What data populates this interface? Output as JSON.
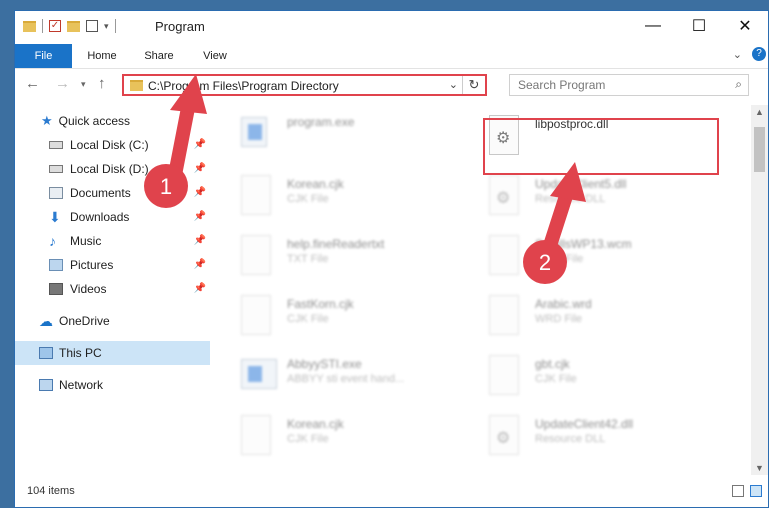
{
  "window": {
    "title": "Program"
  },
  "window_buttons": {
    "minimize": "—",
    "maximize": "☐",
    "close": "✕"
  },
  "ribbon": {
    "tabs": [
      "File",
      "Home",
      "Share",
      "View"
    ]
  },
  "address": {
    "path": "C:\\Program Files\\Program Directory",
    "dropdown": "⌄",
    "refresh": "↻"
  },
  "search": {
    "placeholder": "Search Program"
  },
  "sidebar": {
    "items": [
      {
        "label": "Quick access",
        "icon": "star-icon"
      },
      {
        "label": "Local Disk (C:)",
        "icon": "drive-icon",
        "pinned": true
      },
      {
        "label": "Local Disk (D:)",
        "icon": "drive-icon",
        "pinned": true
      },
      {
        "label": "Documents",
        "icon": "documents-icon",
        "pinned": true
      },
      {
        "label": "Downloads",
        "icon": "download-icon",
        "pinned": true
      },
      {
        "label": "Music",
        "icon": "music-icon",
        "pinned": true
      },
      {
        "label": "Pictures",
        "icon": "pictures-icon",
        "pinned": true
      },
      {
        "label": "Videos",
        "icon": "videos-icon",
        "pinned": true
      },
      {
        "label": "OneDrive",
        "icon": "cloud-icon"
      },
      {
        "label": "This PC",
        "icon": "computer-icon",
        "selected": true
      },
      {
        "label": "Network",
        "icon": "network-icon"
      }
    ]
  },
  "files": [
    {
      "name": "program.exe",
      "type": "",
      "icon": "exe-icon",
      "highlighted": false
    },
    {
      "name": "libpostproc.dll",
      "type": "",
      "icon": "dll-gear-icon",
      "highlighted": true
    },
    {
      "name": "Korean.cjk",
      "type": "CJK File",
      "icon": "file-icon",
      "highlighted": false
    },
    {
      "name": "UpdateClient5.dll",
      "type": "Resource DLL",
      "icon": "dll-gear-icon",
      "highlighted": false
    },
    {
      "name": "help.fineReadertxt",
      "type": "TXT File",
      "icon": "file-icon",
      "highlighted": false
    },
    {
      "name": "SmallsWP13.wcm",
      "type": "WCM File",
      "icon": "file-icon",
      "highlighted": false
    },
    {
      "name": "FastKorn.cjk",
      "type": "CJK File",
      "icon": "file-icon",
      "highlighted": false
    },
    {
      "name": "Arabic.wrd",
      "type": "WRD File",
      "icon": "file-icon",
      "highlighted": false
    },
    {
      "name": "AbbyySTI.exe",
      "type": "ABBYY sti event hand...",
      "icon": "exe-icon",
      "highlighted": false
    },
    {
      "name": "gbt.cjk",
      "type": "CJK File",
      "icon": "file-icon",
      "highlighted": false
    },
    {
      "name": "Korean.cjk",
      "type": "CJK File",
      "icon": "file-icon",
      "highlighted": false
    },
    {
      "name": "UpdateClient42.dll",
      "type": "Resource DLL",
      "icon": "dll-gear-icon",
      "highlighted": false
    }
  ],
  "status": {
    "item_count": "104 items"
  },
  "callouts": [
    {
      "label": "1",
      "target": "address-bar"
    },
    {
      "label": "2",
      "target": "libpostproc.dll"
    }
  ],
  "colors": {
    "accent": "#1a73c8",
    "highlight": "#e0434c",
    "selected": "#cce4f7"
  }
}
